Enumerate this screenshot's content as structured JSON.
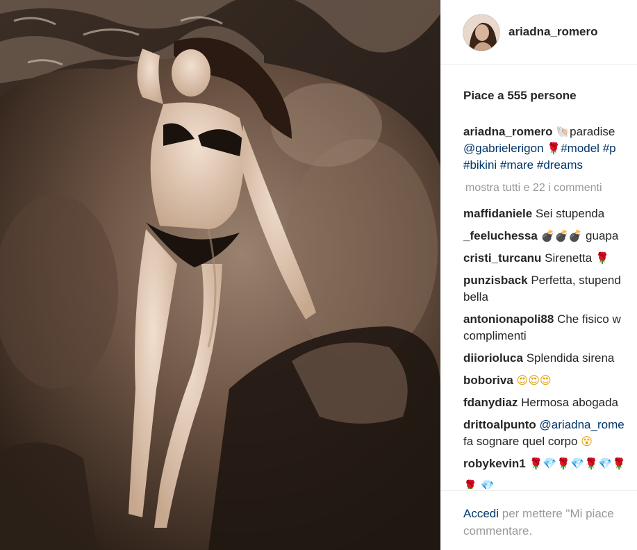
{
  "header": {
    "username": "ariadna_romero"
  },
  "likes_text": "Piace a 555 persone",
  "caption": {
    "user": "ariadna_romero",
    "icon": "shell-icon",
    "text_1": "paradise",
    "mention": "@gabrielerigon",
    "tag_model": "#model",
    "tag_p": "#p",
    "tag_bikini": "#bikini",
    "tag_mare": "#mare",
    "tag_dreams": "#dreams"
  },
  "more_comments": "mostra tutti e 22 i commenti",
  "comments": [
    {
      "user": "maffidaniele",
      "text": "Sei stupenda"
    },
    {
      "user": "_feeluchessa",
      "emoji": "💣💣💣",
      "text": "guapa"
    },
    {
      "user": "cristi_turcanu",
      "text": "Sirenetta",
      "emoji": "🌹"
    },
    {
      "user": "punzisback",
      "text": "Perfetta, stupend",
      "text2": "bella"
    },
    {
      "user": "antonionapoli88",
      "text": "Che fisico w",
      "text2": "complimenti"
    },
    {
      "user": "diiorioluca",
      "text": "Splendida sirena"
    },
    {
      "user": "boboriva",
      "emoji": "😍😍😍"
    },
    {
      "user": "fdanydiaz",
      "text": "Hermosa abogada"
    },
    {
      "user": "drittoalpunto",
      "mention": "@ariadna_rome",
      "text2": "fa sognare quel corpo",
      "emoji": "😵"
    },
    {
      "user": "robykevin1",
      "emoji": "🌹💎🌹💎🌹💎🌹"
    }
  ],
  "footer": {
    "login": "Accedi",
    "text": " per mettere \"Mi piace",
    "text2": "commentare."
  },
  "colors": {
    "link": "#003569",
    "muted": "#999999",
    "text": "#262626"
  }
}
